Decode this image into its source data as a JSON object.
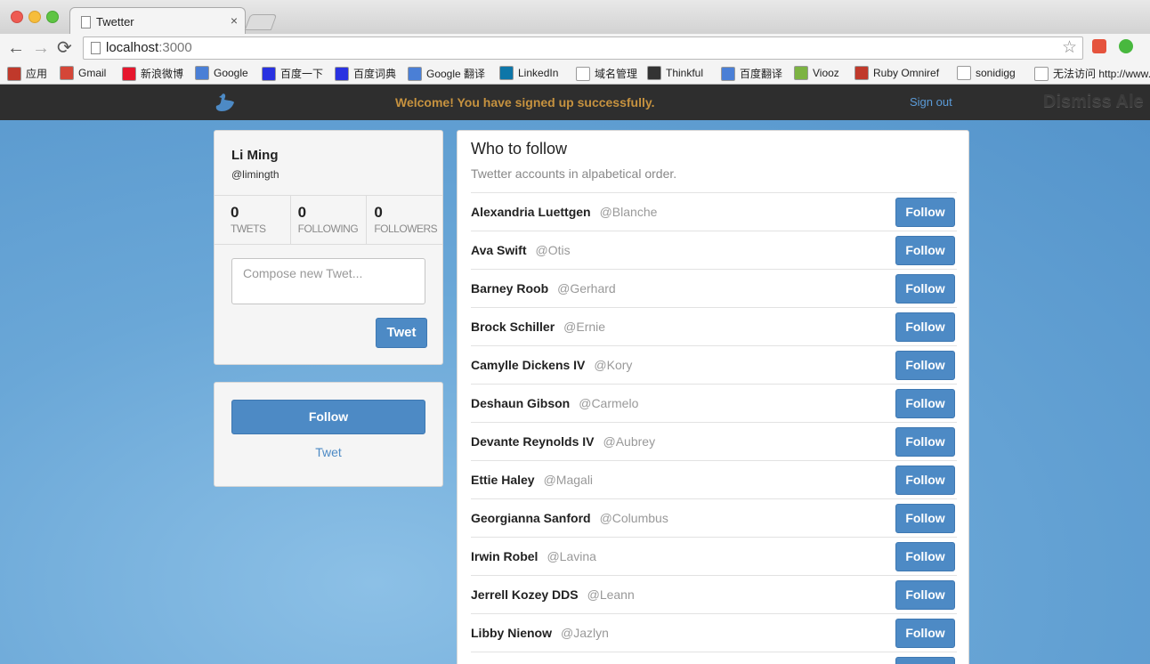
{
  "browser": {
    "tab_title": "Twetter",
    "tab_close": "×",
    "url_host": "localhost",
    "url_port": ":3000",
    "back": "←",
    "forward": "→",
    "reload": "⟳",
    "star": "☆"
  },
  "bookmarks": [
    {
      "label": "应用",
      "icon_color": "#c0392b"
    },
    {
      "label": "Gmail",
      "icon_color": "#d44638"
    },
    {
      "label": "新浪微博",
      "icon_color": "#e6162d"
    },
    {
      "label": "Google",
      "icon_color": "#4a7fd6"
    },
    {
      "label": "百度一下",
      "icon_color": "#2932e1"
    },
    {
      "label": "百度词典",
      "icon_color": "#2932e1"
    },
    {
      "label": "Google 翻译",
      "icon_color": "#4a7fd6"
    },
    {
      "label": "LinkedIn",
      "icon_color": "#0e76a8"
    },
    {
      "label": "域名管理",
      "icon_color": "#ffffff"
    },
    {
      "label": "Thinkful",
      "icon_color": "#333333"
    },
    {
      "label": "百度翻译",
      "icon_color": "#4a7fd6"
    },
    {
      "label": "Viooz",
      "icon_color": "#7cb342"
    },
    {
      "label": "Ruby Omniref",
      "icon_color": "#c0392b"
    },
    {
      "label": "sonidigg",
      "icon_color": "#ffffff"
    },
    {
      "label": "无法访问 http://www.",
      "icon_color": "#ffffff"
    }
  ],
  "navbar": {
    "flash": "Welcome! You have signed up successfully.",
    "signout": "Sign out",
    "dismiss": "Dismiss Ale"
  },
  "profile": {
    "name": "Li Ming",
    "handle": "@limingth",
    "stats": [
      {
        "num": "0",
        "label": "TWETS"
      },
      {
        "num": "0",
        "label": "FOLLOWING"
      },
      {
        "num": "0",
        "label": "FOLLOWERS"
      }
    ],
    "compose_placeholder": "Compose new Twet...",
    "tweet_button": "Twet"
  },
  "sidebar2": {
    "follow_button": "Follow",
    "tweet_link": "Twet"
  },
  "who_to_follow": {
    "title": "Who to follow",
    "subtitle": "Twetter accounts in alpabetical order.",
    "follow_label": "Follow",
    "users": [
      {
        "name": "Alexandria Luettgen",
        "handle": "@Blanche"
      },
      {
        "name": "Ava Swift",
        "handle": "@Otis"
      },
      {
        "name": "Barney Roob",
        "handle": "@Gerhard"
      },
      {
        "name": "Brock Schiller",
        "handle": "@Ernie"
      },
      {
        "name": "Camylle Dickens IV",
        "handle": "@Kory"
      },
      {
        "name": "Deshaun Gibson",
        "handle": "@Carmelo"
      },
      {
        "name": "Devante Reynolds IV",
        "handle": "@Aubrey"
      },
      {
        "name": "Ettie Haley",
        "handle": "@Magali"
      },
      {
        "name": "Georgianna Sanford",
        "handle": "@Columbus"
      },
      {
        "name": "Irwin Robel",
        "handle": "@Lavina"
      },
      {
        "name": "Jerrell Kozey DDS",
        "handle": "@Leann"
      },
      {
        "name": "Libby Nienow",
        "handle": "@Jazlyn"
      }
    ]
  }
}
